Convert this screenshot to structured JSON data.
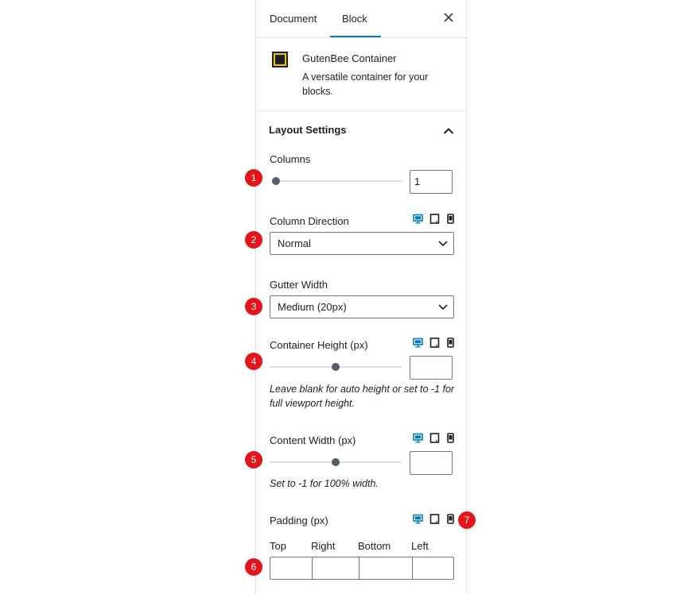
{
  "tabs": [
    {
      "label": "Document"
    },
    {
      "label": "Block"
    }
  ],
  "block": {
    "name": "GutenBee Container",
    "description": "A versatile container for your blocks."
  },
  "section": {
    "title": "Layout Settings"
  },
  "columns": {
    "label": "Columns",
    "value": "1",
    "level": 0.0
  },
  "column_direction": {
    "label": "Column Direction",
    "selected": "Normal"
  },
  "gutter_width": {
    "label": "Gutter Width",
    "selected": "Medium (20px)"
  },
  "container_height": {
    "label": "Container Height (px)",
    "value": "",
    "level": 0.5,
    "help": "Leave blank for auto height or set to -1 for full viewport height."
  },
  "content_width": {
    "label": "Content Width (px)",
    "value": "",
    "level": 0.5,
    "help": "Set to -1 for 100% width."
  },
  "padding": {
    "label": "Padding (px)",
    "sides": [
      "Top",
      "Right",
      "Bottom",
      "Left"
    ],
    "values": [
      "",
      "",
      "",
      ""
    ]
  },
  "markers": [
    "1",
    "2",
    "3",
    "4",
    "5",
    "6",
    "7"
  ],
  "icons": {
    "close": "close-icon",
    "section_toggle": "chevron-up-icon",
    "select": "chevron-down-icon",
    "devices": [
      "desktop-icon",
      "tablet-icon",
      "mobile-icon"
    ]
  },
  "colors": {
    "accent": "#007cba",
    "marker": "#e3141b",
    "block_icon": "#f5c400",
    "slider_thumb": "#555d66"
  }
}
